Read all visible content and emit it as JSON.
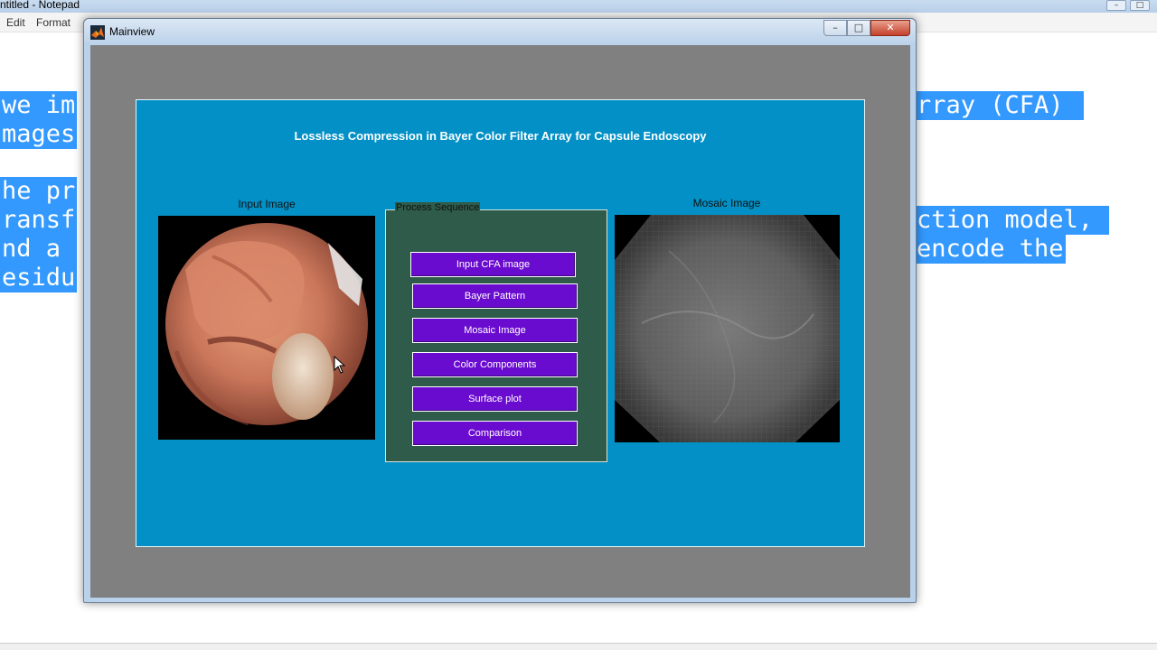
{
  "notepad": {
    "title": "ntitled - Notepad",
    "menu": [
      "Edit",
      "Format"
    ],
    "text_left": [
      "we im",
      "mages",
      "he pr",
      "ransf",
      "nd a ",
      "esidu"
    ],
    "text_right": [
      "rray (CFA)",
      "ction model,",
      "encode the"
    ]
  },
  "window": {
    "title": "Mainview",
    "min_label": "–",
    "max_label": "□",
    "close_label": "✕"
  },
  "app": {
    "title": "Lossless Compression in Bayer Color Filter Array for Capsule Endoscopy",
    "input_label": "Input Image",
    "mosaic_label": "Mosaic Image",
    "process_title": "Process Sequence",
    "buttons": [
      "Input CFA image",
      "Bayer Pattern",
      "Mosaic Image",
      "Color Components",
      "Surface plot",
      "Comparison"
    ]
  },
  "colors": {
    "figure_bg": "#0290c6",
    "panel_bg": "#2f5b4a",
    "button_bg": "#6a0ccf",
    "selection": "#3399ff"
  },
  "icons": {
    "window_logo": "matlab-logo-icon",
    "cursor": "mouse-pointer-icon"
  }
}
